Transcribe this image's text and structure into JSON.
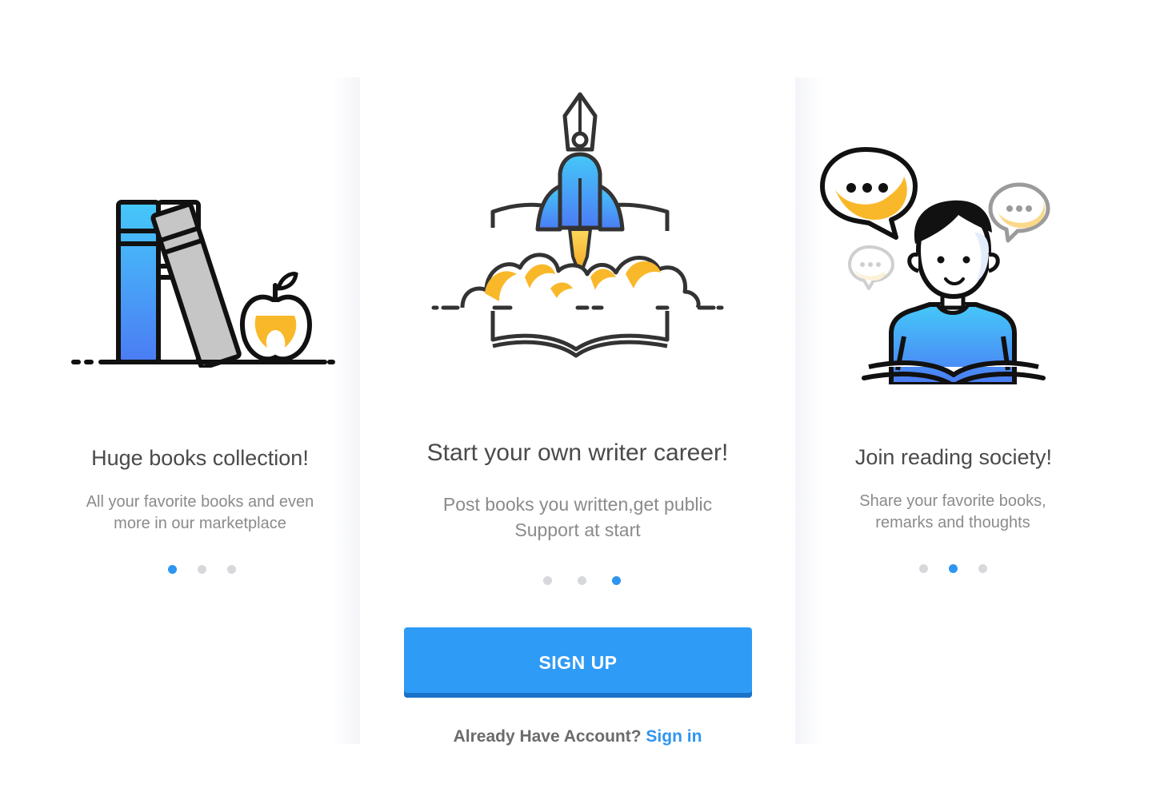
{
  "slides": [
    {
      "title": "Huge books collection!",
      "description_line1": "All your favorite books and even",
      "description_line2": "more in our marketplace",
      "icon": "books-apple-icon",
      "active_dot": 1
    },
    {
      "title": "Start your own writer career!",
      "description_line1": "Post books you written,get public",
      "description_line2": "Support at start",
      "icon": "pen-rocket-book-icon",
      "active_dot": 3
    },
    {
      "title": "Join reading society!",
      "description_line1": "Share your favorite books,",
      "description_line2": "remarks and thoughts",
      "icon": "reader-chat-icon",
      "active_dot": 2
    }
  ],
  "signup_label": "SIGN UP",
  "signin_prompt": "Already Have Account?",
  "signin_link": "Sign in",
  "colors": {
    "accent": "#2e95f0",
    "button": "#2e9bf6",
    "button_shadow": "#1a72c8",
    "yellow": "#f9b82a",
    "dot_inactive": "#d6d8dc",
    "title": "#4a4a4a",
    "description": "#8b8b8b"
  }
}
